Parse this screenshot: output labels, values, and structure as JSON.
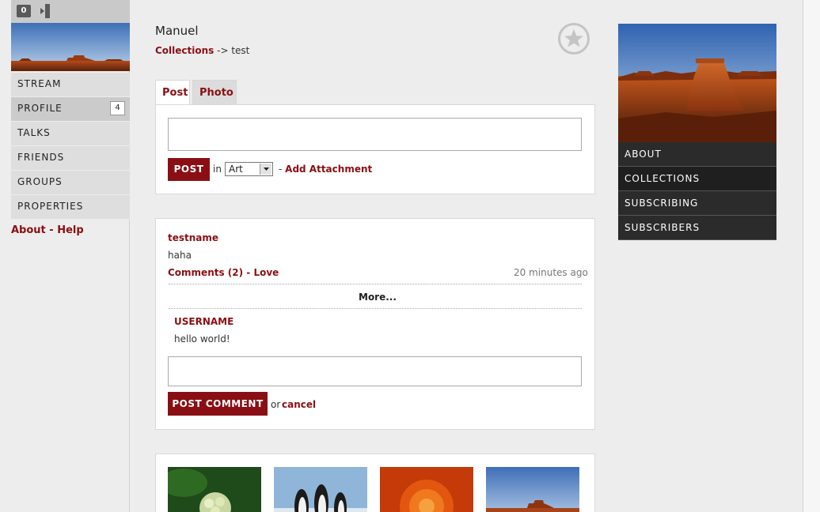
{
  "topbar": {
    "count": "0"
  },
  "left_nav": {
    "items": [
      {
        "label": "STREAM"
      },
      {
        "label": "PROFILE",
        "badge": "4"
      },
      {
        "label": "TALKS"
      },
      {
        "label": "FRIENDS"
      },
      {
        "label": "GROUPS"
      },
      {
        "label": "PROPERTIES"
      }
    ],
    "links": {
      "about": "About",
      "sep": " - ",
      "help": "Help"
    }
  },
  "header": {
    "name": "Manuel",
    "breadcrumb": {
      "link": "Collections",
      "arrow": " -> ",
      "current": "test"
    }
  },
  "tabs": [
    {
      "label": "Post"
    },
    {
      "label": "Photo"
    }
  ],
  "compose": {
    "post_label": "POST",
    "in_label": "in",
    "category": "Art",
    "attach_prefix": "- ",
    "attach_label": "Add Attachment"
  },
  "stream": {
    "author": "testname",
    "body": "haha",
    "comments_label": "Comments (2)",
    "sep": " - ",
    "love_label": "Love",
    "time": "20 minutes ago",
    "more_label": "More...",
    "comment": {
      "author": "USERNAME",
      "text": "hello world!"
    },
    "post_comment_label": "POST COMMENT",
    "or_label": "or",
    "cancel_label": "cancel"
  },
  "right_nav": {
    "items": [
      {
        "label": "ABOUT"
      },
      {
        "label": "COLLECTIONS"
      },
      {
        "label": "SUBSCRIBING"
      },
      {
        "label": "SUBSCRIBERS"
      }
    ]
  },
  "colors": {
    "accent": "#8a0f14",
    "dark_nav": "#2b2b2b"
  }
}
